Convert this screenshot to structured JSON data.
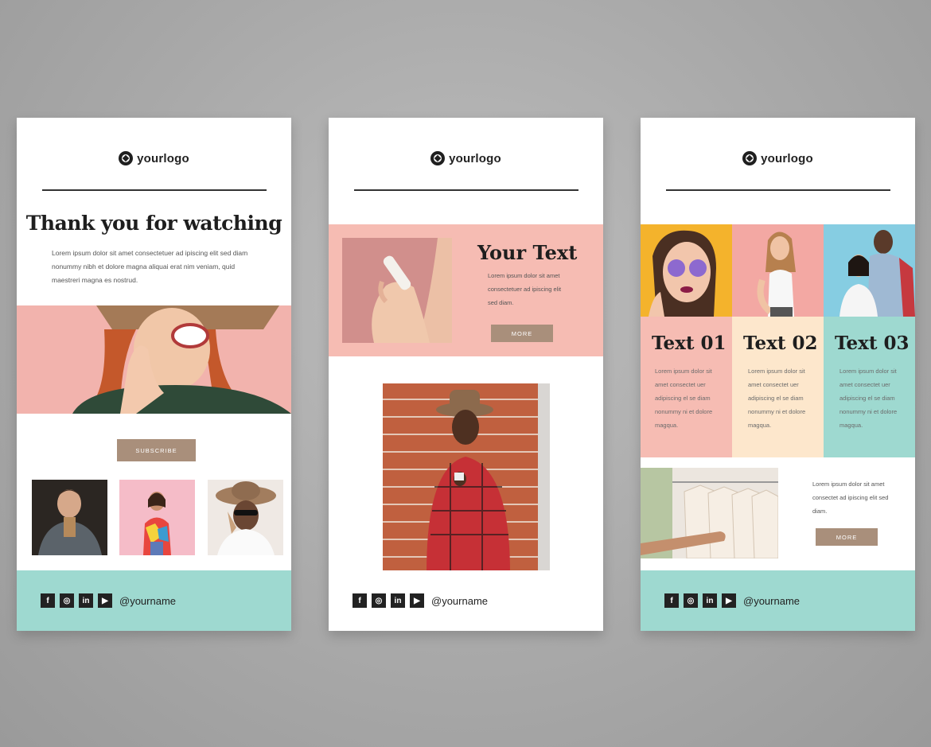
{
  "card1": {
    "logo": "yourlogo",
    "title": "Thank you for watching",
    "body": "Lorem ipsum dolor sit amet consectetuer ad ipiscing elit sed diam nonummy nibh et dolore magna aliquai erat nim veniam, quid maestreri magna es nostrud.",
    "button": "SUBSCRIBE",
    "handle": "@yourname"
  },
  "card2": {
    "logo": "yourlogo",
    "title": "Your Text",
    "body": "Lorem ipsum dolor sit amet consectetuer ad ipiscing elit sed diam.",
    "button": "MORE",
    "handle": "@yourname"
  },
  "card3": {
    "logo": "yourlogo",
    "columns": [
      {
        "title": "Text 01",
        "body": "Lorem ipsum dolor sit amet consectet uer adipiscing el se diam nonummy ni et dolore magqua."
      },
      {
        "title": "Text 02",
        "body": "Lorem ipsum dolor sit amet consectet uer adipiscing el se diam nonummy ni et dolore magqua."
      },
      {
        "title": "Text 03",
        "body": "Lorem ipsum dolor sit amet consectet uer adipiscing el se diam nonummy ni et dolore magqua."
      }
    ],
    "body": "Lorem ipsum dolor sit amet consectet ad ipiscing elit sed diam.",
    "button": "MORE",
    "handle": "@yourname"
  },
  "social": {
    "facebook": "f",
    "instagram": "◎",
    "linkedin": "in",
    "youtube": "▶"
  },
  "colors": {
    "pink": "#f6bcb3",
    "mint": "#9ed9d0",
    "cream": "#fde7cc",
    "button": "#a98f7b",
    "background": "#b3b3b3"
  }
}
